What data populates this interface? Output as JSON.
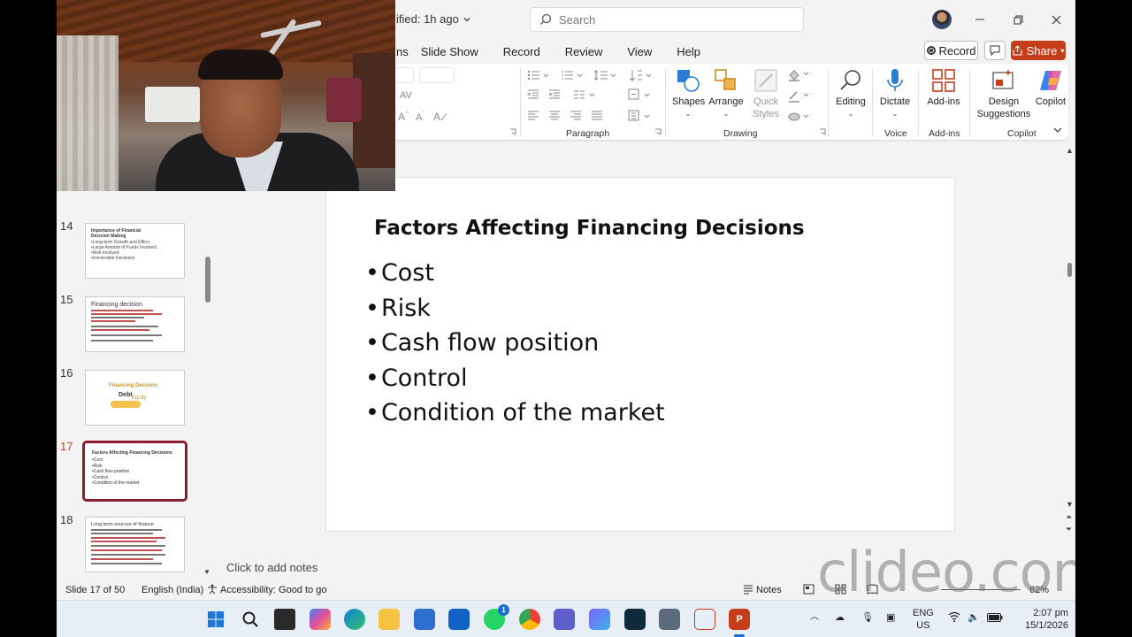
{
  "titlebar": {
    "doc_status": "ified: 1h ago",
    "search_placeholder": "Search"
  },
  "ribbon_tabs": [
    "ns",
    "Slide Show",
    "Record",
    "Review",
    "View",
    "Help"
  ],
  "actions": {
    "record": "Record",
    "share": "Share"
  },
  "ribbon": {
    "groups": {
      "paragraph": "Paragraph",
      "drawing": "Drawing",
      "voice": "Voice",
      "addins": "Add-ins",
      "copilot": "Copilot"
    },
    "buttons": {
      "shapes": "Shapes",
      "arrange": "Arrange",
      "quick_styles_1": "Quick",
      "quick_styles_2": "Styles",
      "editing": "Editing",
      "dictate": "Dictate",
      "addins": "Add-ins",
      "design_1": "Design",
      "design_2": "Suggestions",
      "copilot": "Copilot"
    }
  },
  "thumbnails": [
    {
      "number": "14",
      "title": "Importance of Financial Decision Making",
      "lines": [
        "•Long-term Growth and Effect",
        "•Large Amount of Funds Involved",
        "•Risk Involved",
        "•Irreversible Decisions"
      ]
    },
    {
      "number": "15",
      "title": "Financing decision"
    },
    {
      "number": "16",
      "title": "Financing Decision",
      "sub1": "Debt",
      "sub2": "Equity"
    },
    {
      "number": "17",
      "title": "Factors Affecting Financing Decisions",
      "lines": [
        "•Cost",
        "•Risk",
        "•Cash flow position",
        "•Control",
        "•Condition of the market"
      ]
    },
    {
      "number": "18",
      "title": "Long term sources of finance"
    }
  ],
  "slide": {
    "title": "Factors Affecting Financing Decisions",
    "bullets": [
      "Cost",
      "Risk",
      "Cash flow position",
      "Control",
      "Condition of the market"
    ]
  },
  "notes_placeholder": "Click to add notes",
  "statusbar": {
    "slide_info": "Slide 17 of 50",
    "language": "English (India)",
    "accessibility": "Accessibility: Good to go",
    "notes": "Notes",
    "zoom": "62%"
  },
  "watermark": "clideo.com",
  "taskbar": {
    "lang_1": "ENG",
    "lang_2": "US",
    "time": "2:07 pm",
    "date": "15/1/2026",
    "whatsapp_badge": "1"
  },
  "colors": {
    "accent": "#c43e1c",
    "selected_thumb": "#8a1e2f"
  }
}
